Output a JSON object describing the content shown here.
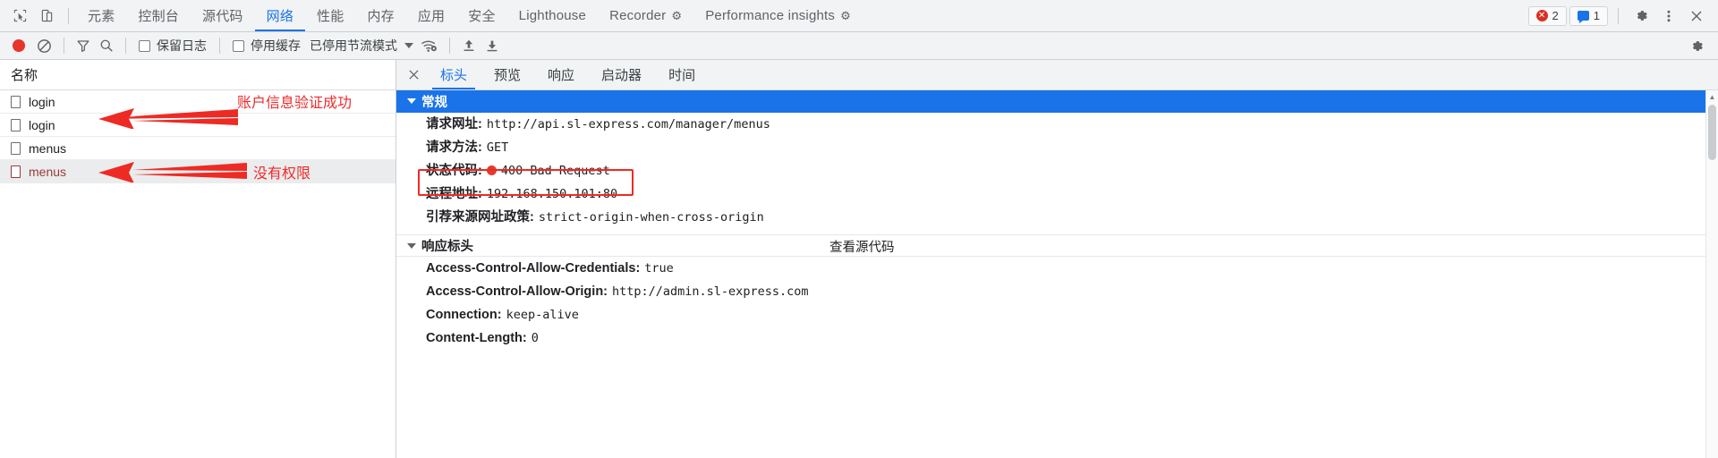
{
  "topbar": {
    "inspect_icon": "inspect-cursor-icon",
    "device_icon": "device-toolbar-icon",
    "tabs": [
      {
        "label": "元素",
        "active": false
      },
      {
        "label": "控制台",
        "active": false
      },
      {
        "label": "源代码",
        "active": false
      },
      {
        "label": "网络",
        "active": true
      },
      {
        "label": "性能",
        "active": false
      },
      {
        "label": "内存",
        "active": false
      },
      {
        "label": "应用",
        "active": false
      },
      {
        "label": "安全",
        "active": false
      },
      {
        "label": "Lighthouse",
        "active": false
      },
      {
        "label": "Recorder",
        "active": false,
        "flask": true
      },
      {
        "label": "Performance insights",
        "active": false,
        "flask": true
      }
    ],
    "error_count": "2",
    "warning_count": "1",
    "settings_icon": "gear-icon",
    "more_icon": "kebab-menu-icon",
    "close_icon": "close-icon"
  },
  "toolbar2": {
    "record_icon": "record-button-icon",
    "clear_icon": "clear-network-log-icon",
    "filter_icon": "filter-icon",
    "search_icon": "search-icon",
    "preserve_log": "保留日志",
    "disable_cache": "停用缓存",
    "throttling": "已停用节流模式",
    "network_conditions_icon": "network-conditions-icon",
    "import_icon": "import-har-icon",
    "export_icon": "export-har-icon",
    "settings_icon": "settings-gear-icon"
  },
  "request_list": {
    "column_header": "名称",
    "rows": [
      {
        "name": "login",
        "selected": false
      },
      {
        "name": "login",
        "selected": false
      },
      {
        "name": "menus",
        "selected": false
      },
      {
        "name": "menus",
        "selected": true
      }
    ]
  },
  "annotations": [
    {
      "text": "账户信息验证成功",
      "kind": "arrow-label"
    },
    {
      "text": "没有权限",
      "kind": "arrow-label"
    }
  ],
  "detail": {
    "close_label": "✕",
    "tabs": [
      {
        "label": "标头",
        "active": true
      },
      {
        "label": "预览",
        "active": false
      },
      {
        "label": "响应",
        "active": false
      },
      {
        "label": "启动器",
        "active": false
      },
      {
        "label": "时间",
        "active": false
      }
    ],
    "general": {
      "section_title": "常规",
      "rows": [
        {
          "key": "请求网址:",
          "value": "http://api.sl-express.com/manager/menus"
        },
        {
          "key": "请求方法:",
          "value": "GET"
        },
        {
          "key": "状态代码:",
          "value": "400 Bad Request",
          "status_dot": true
        },
        {
          "key": "远程地址:",
          "value": "192.168.150.101:80"
        },
        {
          "key": "引荐来源网址政策:",
          "value": "strict-origin-when-cross-origin"
        }
      ]
    },
    "response_headers": {
      "section_title": "响应标头",
      "view_source": "查看源代码",
      "rows": [
        {
          "key": "Access-Control-Allow-Credentials:",
          "value": "true"
        },
        {
          "key": "Access-Control-Allow-Origin:",
          "value": "http://admin.sl-express.com"
        },
        {
          "key": "Connection:",
          "value": "keep-alive"
        },
        {
          "key": "Content-Length:",
          "value": "0"
        }
      ]
    }
  },
  "colors": {
    "accent": "#1a73e8",
    "error": "#d93025",
    "annotation": "#ee2a24",
    "toolbar_bg": "#f1f3f4"
  }
}
